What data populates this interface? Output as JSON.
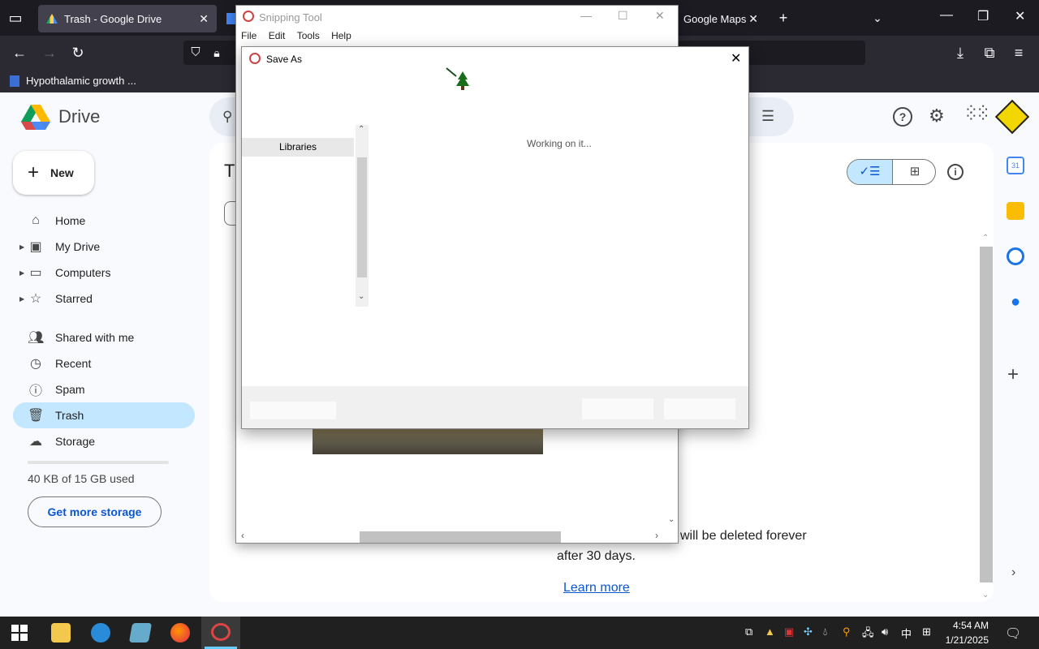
{
  "browser": {
    "tabs": [
      {
        "label": "Trash - Google Drive",
        "active": true
      },
      {
        "label": "Google Maps",
        "active": false
      }
    ],
    "bookmark": "Hypothalamic growth ..."
  },
  "drive": {
    "app_name": "Drive",
    "new_label": "New",
    "nav": [
      {
        "label": "Home",
        "icon": "home-icon"
      },
      {
        "label": "My Drive",
        "icon": "my-drive-icon"
      },
      {
        "label": "Computers",
        "icon": "computers-icon"
      },
      {
        "label": "Starred",
        "icon": "star-icon"
      },
      {
        "label": "Shared with me",
        "icon": "shared-icon"
      },
      {
        "label": "Recent",
        "icon": "clock-icon"
      },
      {
        "label": "Spam",
        "icon": "spam-icon"
      },
      {
        "label": "Trash",
        "icon": "trash-icon"
      },
      {
        "label": "Storage",
        "icon": "cloud-icon"
      }
    ],
    "storage_used": "40 KB of 15 GB used",
    "storage_button": "Get more storage",
    "page_title_fragment": "T",
    "trash_notice_line1": "will be deleted forever",
    "trash_notice_line2": "after 30 days.",
    "learn_more": "Learn more"
  },
  "snipping_tool": {
    "title": "Snipping Tool",
    "menu": [
      "File",
      "Edit",
      "Tools",
      "Help"
    ]
  },
  "save_as": {
    "title": "Save As",
    "sidebar_item": "Libraries",
    "status": "Working on it..."
  },
  "taskbar": {
    "time": "4:54 AM",
    "date": "1/21/2025",
    "ime": "中"
  },
  "colors": {
    "drive_active_nav": "#c2e7ff",
    "drive_link": "#0b57d0",
    "firefox_tabbar": "#1c1b22",
    "taskbar": "#202020"
  }
}
